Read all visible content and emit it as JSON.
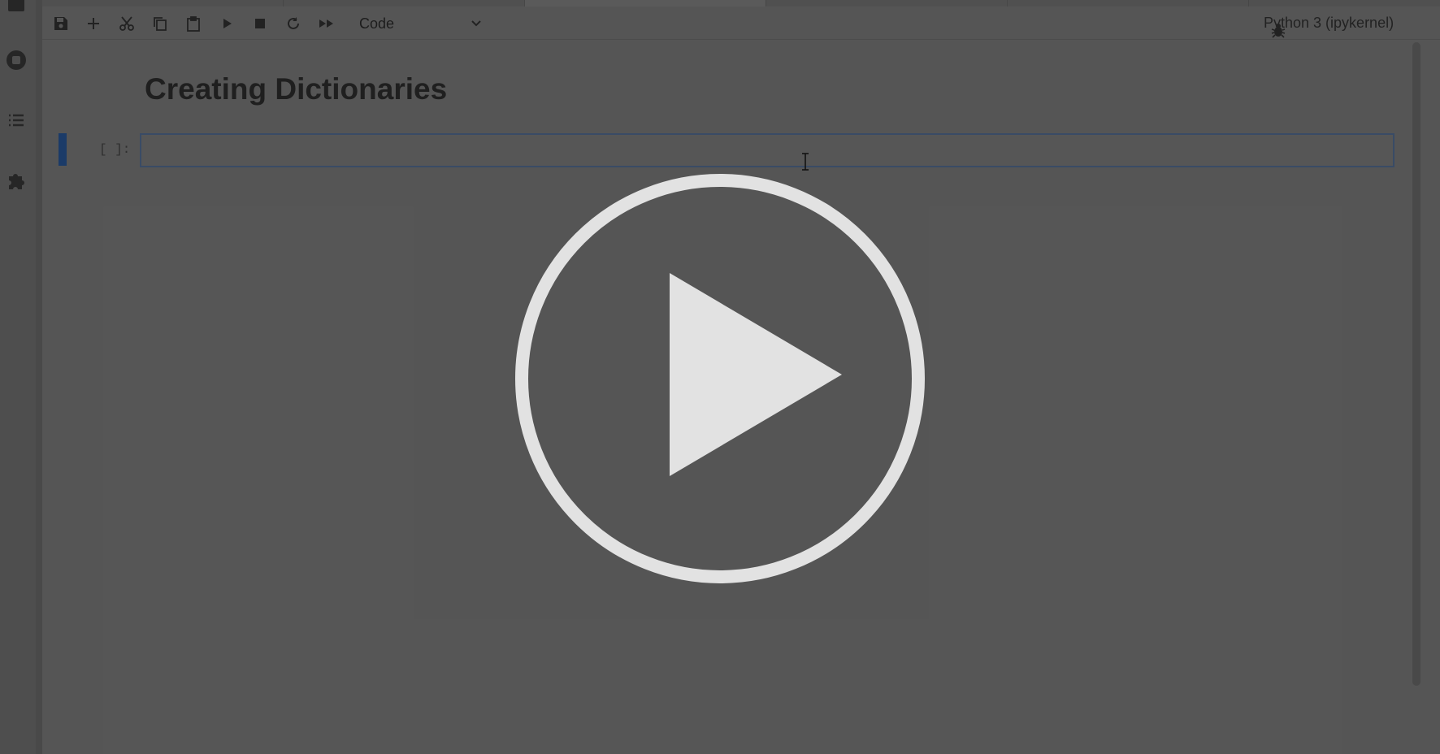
{
  "toolbar": {
    "cell_type": "Code",
    "kernel_name": "Python 3 (ipykernel)"
  },
  "notebook": {
    "heading": "Creating Dictionaries",
    "cells": [
      {
        "prompt": "[ ]:",
        "source": ""
      }
    ]
  },
  "icons": {
    "sidebar": [
      "running-icon",
      "toc-icon",
      "extension-icon"
    ],
    "toolbar": [
      "save-icon",
      "add-cell-icon",
      "cut-icon",
      "copy-icon",
      "paste-icon",
      "run-icon",
      "stop-icon",
      "restart-icon",
      "fast-forward-icon",
      "chevron-down-icon",
      "bug-icon",
      "kernel-status-icon"
    ],
    "overlay": "play-icon"
  },
  "colors": {
    "overlay_play": "#e2e2e2",
    "active_cell_marker": "#1b3d6e"
  }
}
